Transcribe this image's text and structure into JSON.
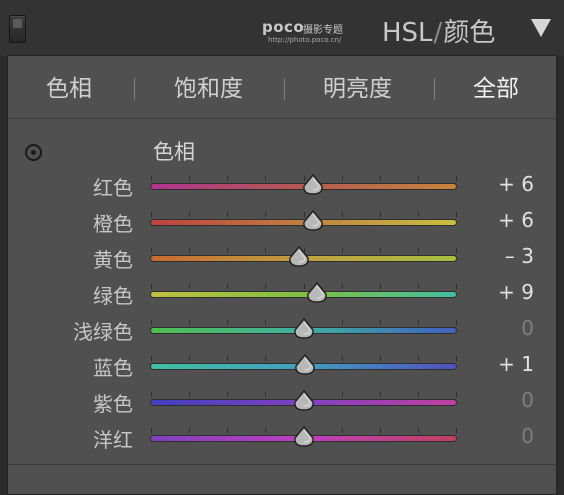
{
  "header": {
    "watermark_logo": "poco",
    "watermark_text": "摄影专题",
    "watermark_url": "http://photo.poco.cn/",
    "title": "HSL",
    "title_separator": "/",
    "title_secondary": "颜色"
  },
  "tabs": [
    {
      "label": "色相"
    },
    {
      "label": "饱和度"
    },
    {
      "label": "明亮度"
    },
    {
      "label": "全部"
    }
  ],
  "active_tab": "全部",
  "section": {
    "title": "色相"
  },
  "sliders": [
    {
      "label": "红色",
      "value": "+ 6",
      "numeric": 6,
      "gradient": [
        "#b0348c",
        "#b55a52",
        "#c8843a"
      ]
    },
    {
      "label": "橙色",
      "value": "+ 6",
      "numeric": 6,
      "gradient": [
        "#c04040",
        "#c08040",
        "#c8c040"
      ]
    },
    {
      "label": "黄色",
      "value": "– 3",
      "numeric": -3,
      "gradient": [
        "#c86a30",
        "#c0a040",
        "#a8c040"
      ]
    },
    {
      "label": "绿色",
      "value": "+ 9",
      "numeric": 9,
      "gradient": [
        "#c0c040",
        "#80c040",
        "#40c0a0"
      ]
    },
    {
      "label": "浅绿色",
      "value": "0",
      "numeric": 0,
      "gradient": [
        "#50c050",
        "#40b0a0",
        "#4060c0"
      ]
    },
    {
      "label": "蓝色",
      "value": "+ 1",
      "numeric": 1,
      "gradient": [
        "#40c0a0",
        "#40a0c0",
        "#5050c0"
      ]
    },
    {
      "label": "紫色",
      "value": "0",
      "numeric": 0,
      "gradient": [
        "#4040c0",
        "#8040c0",
        "#c040a0"
      ]
    },
    {
      "label": "洋红",
      "value": "0",
      "numeric": 0,
      "gradient": [
        "#8040c0",
        "#c040c0",
        "#c04060"
      ]
    }
  ],
  "slider_range": [
    -100,
    100
  ],
  "colors": {
    "panel_bg": "#505050",
    "header_bg": "#333333",
    "text": "#d0d0d0",
    "zero_value": "#7e7e7e"
  }
}
